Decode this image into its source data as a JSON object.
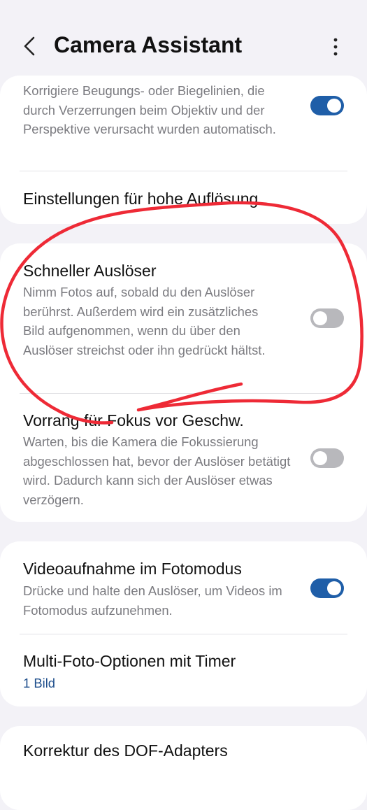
{
  "header": {
    "title": "Camera Assistant",
    "back_icon": "chevron-left-icon",
    "more_icon": "more-vertical-icon"
  },
  "card1": {
    "lens_correction": {
      "description": "Korrigiere Beugungs- oder Biegelinien, die durch Verzerrungen beim Objektiv und der Perspektive verursacht wurden automatisch.",
      "enabled": true
    },
    "high_res": {
      "title": "Einstellungen für hohe Auflösung"
    }
  },
  "card2": {
    "quick_shutter": {
      "title": "Schneller Auslöser",
      "description": "Nimm Fotos auf, sobald du den Auslöser berührst. Außerdem wird ein zusätzliches Bild aufgenommen, wenn du über den Auslöser streichst oder ihn gedrückt hältst.",
      "enabled": false
    },
    "focus_priority": {
      "title": "Vorrang für Fokus vor Geschw.",
      "description": "Warten, bis die Kamera die Fokussierung abgeschlossen hat, bevor der Auslöser betätigt wird. Dadurch kann sich der Auslöser etwas verzögern.",
      "enabled": false
    }
  },
  "card3": {
    "video_in_photo": {
      "title": "Videoaufnahme im Fotomodus",
      "description": "Drücke und halte den Auslöser, um Videos im Fotomodus aufzunehmen.",
      "enabled": true
    },
    "multi_photo_timer": {
      "title": "Multi-Foto-Optionen mit Timer",
      "value": "1 Bild"
    }
  },
  "card4": {
    "dof_adapter": {
      "title": "Korrektur des DOF-Adapters"
    }
  },
  "colors": {
    "background": "#f3f2f7",
    "card": "#ffffff",
    "toggle_on": "#1f5ea8",
    "toggle_off": "#b8b8bc",
    "value_text": "#1f4f8c",
    "annotation": "#ee2a36"
  }
}
